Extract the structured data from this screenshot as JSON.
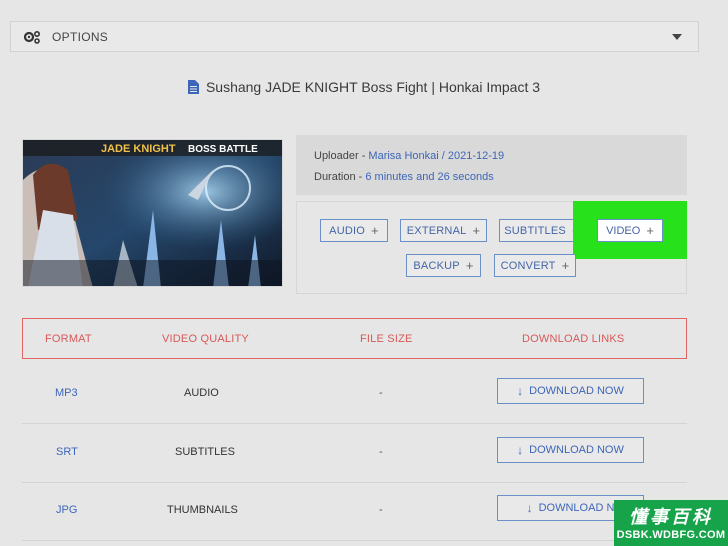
{
  "options": {
    "label": "OPTIONS"
  },
  "video": {
    "title": "Sushang JADE KNIGHT Boss Fight | Honkai Impact 3"
  },
  "thumbnail": {
    "caption_main": "JADE KNIGHT",
    "caption_sub": "BOSS BATTLE"
  },
  "meta": {
    "uploader_label": "Uploader - ",
    "uploader_value": "Marisa Honkai / 2021-12-19",
    "duration_label": "Duration - ",
    "duration_value": "6 minutes and 26 seconds"
  },
  "formats": {
    "audio": "AUDIO",
    "external": "EXTERNAL",
    "subtitles": "SUBTITLES",
    "video": "VIDEO",
    "backup": "BACKUP",
    "convert": "CONVERT",
    "plus": "+"
  },
  "table": {
    "headers": [
      "FORMAT",
      "VIDEO QUALITY",
      "FILE SIZE",
      "DOWNLOAD LINKS"
    ],
    "rows": [
      {
        "format": "MP3",
        "quality": "AUDIO",
        "size": "-",
        "action": "DOWNLOAD NOW"
      },
      {
        "format": "SRT",
        "quality": "SUBTITLES",
        "size": "-",
        "action": "DOWNLOAD NOW"
      },
      {
        "format": "JPG",
        "quality": "THUMBNAILS",
        "size": "-",
        "action": "DOWNLOAD N"
      }
    ]
  },
  "watermark": {
    "cn": "懂事百科",
    "en": "DSBK.WDBFG.COM"
  },
  "colors": {
    "accent": "#3d66b8",
    "highlight": "#27e11a",
    "header_red": "#d75959"
  }
}
